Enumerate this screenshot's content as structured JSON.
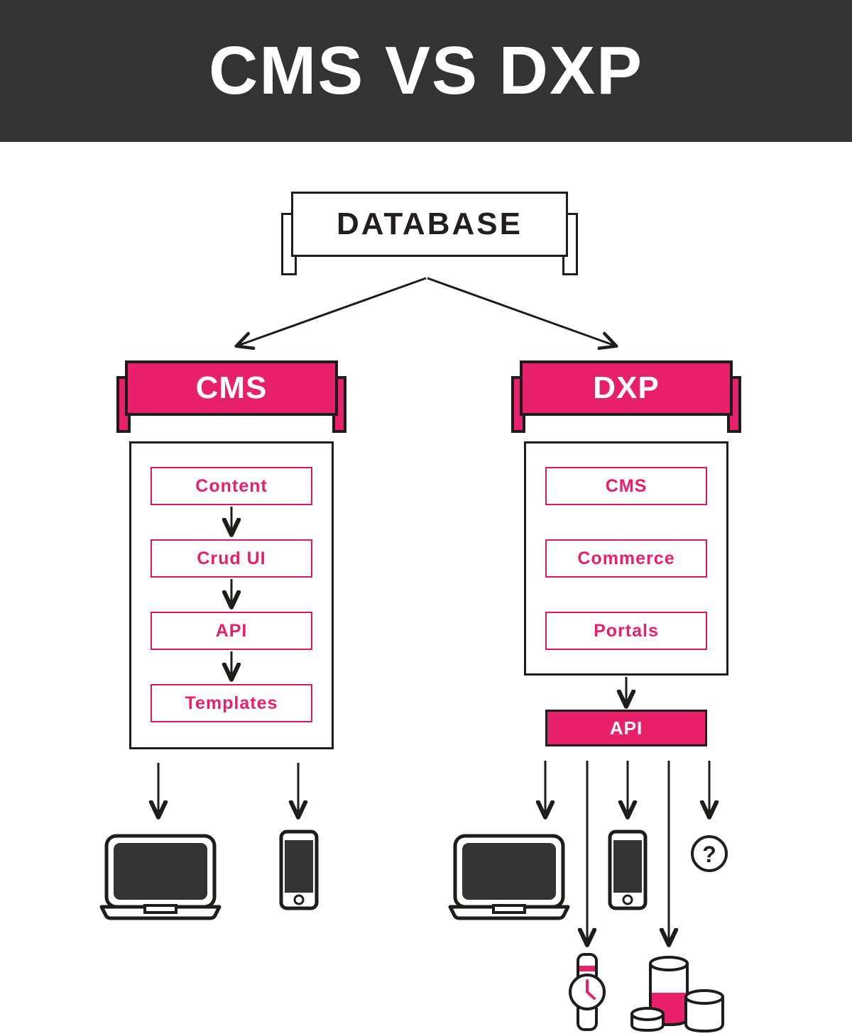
{
  "header": {
    "title": "CMS VS DXP",
    "background_color": "#333333",
    "text_color": "#ffffff"
  },
  "colors": {
    "pink": "#e8206b",
    "pink_border": "#d81b60",
    "ink": "#1d1d1b",
    "background": "#ffffff",
    "device_screen": "#333333"
  },
  "source": {
    "label": "DATABASE",
    "style": "outlined-banner"
  },
  "columns": [
    {
      "key": "cms",
      "banner_label": "CMS",
      "banner_style": "pink-banner",
      "items": [
        {
          "label": "Content"
        },
        {
          "label": "Crud UI"
        },
        {
          "label": "API"
        },
        {
          "label": "Templates"
        }
      ],
      "items_connected_by_arrows": true,
      "api_box": null,
      "outputs": [
        {
          "name": "laptop",
          "icon": "laptop-icon"
        },
        {
          "name": "phone",
          "icon": "phone-icon"
        }
      ]
    },
    {
      "key": "dxp",
      "banner_label": "DXP",
      "banner_style": "pink-banner",
      "items": [
        {
          "label": "CMS"
        },
        {
          "label": "Commerce"
        },
        {
          "label": "Portals"
        }
      ],
      "items_connected_by_arrows": false,
      "api_box": {
        "label": "API",
        "style": "filled-pink"
      },
      "outputs": [
        {
          "name": "laptop",
          "icon": "laptop-icon"
        },
        {
          "name": "smartwatch",
          "icon": "smartwatch-icon"
        },
        {
          "name": "phone",
          "icon": "phone-icon"
        },
        {
          "name": "smart-speakers",
          "icon": "smart-speakers-icon"
        },
        {
          "name": "unknown-device",
          "icon": "question-mark-icon",
          "label": "?"
        }
      ]
    }
  ]
}
